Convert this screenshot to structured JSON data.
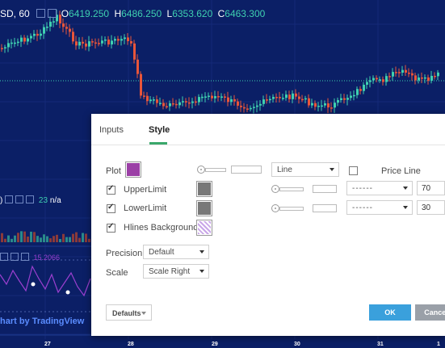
{
  "chart_header": {
    "symbol": "SD, 60",
    "open_key": "O",
    "open": "6419.250",
    "high_key": "H",
    "high": "6486.250",
    "low_key": "L",
    "low": "6353.620",
    "close_key": "C",
    "close": "6463.300"
  },
  "indicator1": {
    "prefix": ")",
    "value": "23",
    "na": "n/a"
  },
  "indicator2": {
    "value": "15.2066"
  },
  "brand": "hart by TradingView",
  "x_axis": [
    "27",
    "28",
    "29",
    "30",
    "31",
    "1"
  ],
  "colors": {
    "up": "#3fd0b0",
    "down": "#e8553a",
    "bg": "#0b1f66",
    "accent": "#3aa86b",
    "ok": "#3aa0dc",
    "purple": "#9b3fa6"
  },
  "dialog": {
    "tabs": [
      {
        "label": "Inputs"
      },
      {
        "label": "Style"
      }
    ],
    "plot_label": "Plot",
    "line_style": "Line",
    "price_line": "Price Line",
    "upper_label": "UpperLimit",
    "upper_value": "70",
    "lower_label": "LowerLimit",
    "lower_value": "30",
    "dash_text": "------",
    "bg_label": "Hlines Background",
    "precision_label": "Precision",
    "precision_value": "Default",
    "scale_label": "Scale",
    "scale_value": "Scale Right",
    "defaults_label": "Defaults",
    "ok_label": "OK",
    "cancel_label": "Cancel"
  }
}
